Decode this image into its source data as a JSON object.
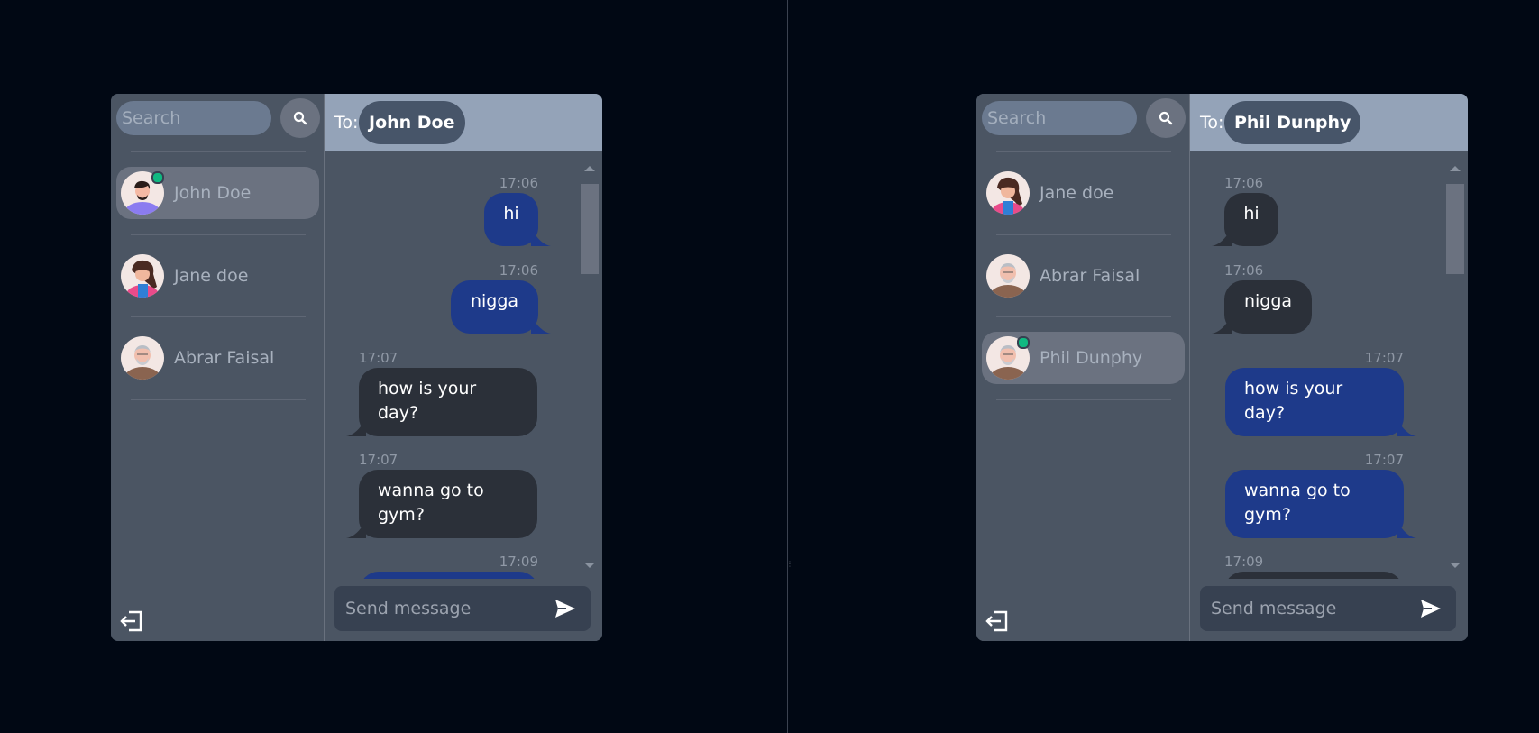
{
  "left": {
    "search": {
      "placeholder": "Search"
    },
    "contacts": [
      {
        "name": "John Doe",
        "avatar": "avatar-man",
        "active": true,
        "online": true
      },
      {
        "name": "Jane doe",
        "avatar": "avatar-woman",
        "active": false,
        "online": false
      },
      {
        "name": "Abrar Faisal",
        "avatar": "avatar-old-man",
        "active": false,
        "online": false
      }
    ],
    "chat": {
      "to_label": "To:",
      "recipient": "John Doe",
      "messages": [
        {
          "time": "17:06",
          "text": "hi",
          "from_me": true
        },
        {
          "time": "17:06",
          "text": "nigga",
          "from_me": true
        },
        {
          "time": "17:07",
          "text": "how is your day?",
          "from_me": false
        },
        {
          "time": "17:07",
          "text": "wanna go to gym?",
          "from_me": false
        },
        {
          "time": "17:09",
          "text": "",
          "from_me": true
        }
      ],
      "input_placeholder": "Send message"
    }
  },
  "right": {
    "search": {
      "placeholder": "Search"
    },
    "contacts": [
      {
        "name": "Jane doe",
        "avatar": "avatar-woman",
        "active": false,
        "online": false
      },
      {
        "name": "Abrar Faisal",
        "avatar": "avatar-old-man",
        "active": false,
        "online": false
      },
      {
        "name": "Phil Dunphy",
        "avatar": "avatar-old-man",
        "active": true,
        "online": true
      }
    ],
    "chat": {
      "to_label": "To:",
      "recipient": "Phil Dunphy",
      "messages": [
        {
          "time": "17:06",
          "text": "hi",
          "from_me": false
        },
        {
          "time": "17:06",
          "text": "nigga",
          "from_me": false
        },
        {
          "time": "17:07",
          "text": "how is your day?",
          "from_me": true
        },
        {
          "time": "17:07",
          "text": "wanna go to gym?",
          "from_me": true
        },
        {
          "time": "17:09",
          "text": "",
          "from_me": false
        }
      ],
      "input_placeholder": "Send message"
    }
  },
  "icons": {
    "search": "search-icon",
    "logout": "logout-icon",
    "send": "send-icon"
  },
  "colors": {
    "background": "#010814",
    "panel": "#4b5563",
    "header": "#94a3b8",
    "sent_bubble": "#1e3a8a",
    "received_bubble": "#2b3039",
    "online": "#10b981"
  }
}
